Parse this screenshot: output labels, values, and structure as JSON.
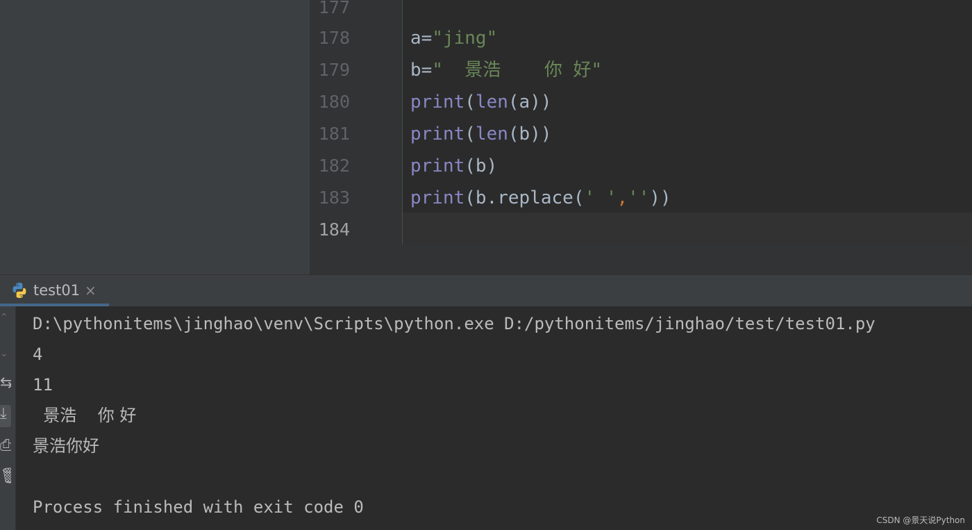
{
  "editor": {
    "lines": [
      {
        "num": "177",
        "code": ""
      },
      {
        "num": "178",
        "parts": [
          [
            "op",
            "a="
          ],
          [
            "str",
            "\"jing\""
          ]
        ]
      },
      {
        "num": "179",
        "parts": [
          [
            "op",
            "b="
          ],
          [
            "str",
            "\"  景浩    你 好\""
          ]
        ]
      },
      {
        "num": "180",
        "parts": [
          [
            "kw",
            "print"
          ],
          [
            "op",
            "("
          ],
          [
            "kw",
            "len"
          ],
          [
            "op",
            "(a))"
          ]
        ]
      },
      {
        "num": "181",
        "parts": [
          [
            "kw",
            "print"
          ],
          [
            "op",
            "("
          ],
          [
            "kw",
            "len"
          ],
          [
            "op",
            "(b))"
          ]
        ]
      },
      {
        "num": "182",
        "parts": [
          [
            "kw",
            "print"
          ],
          [
            "op",
            "(b)"
          ]
        ]
      },
      {
        "num": "183",
        "parts": [
          [
            "kw",
            "print"
          ],
          [
            "op",
            "(b.replace("
          ],
          [
            "str",
            "' '"
          ],
          [
            "comma",
            ","
          ],
          [
            "str",
            "''"
          ],
          [
            "op",
            "))"
          ]
        ]
      },
      {
        "num": "184",
        "code": ""
      }
    ]
  },
  "run": {
    "tab_label": "test01",
    "close_glyph": "×",
    "icons": [
      "python-icon",
      "close-icon",
      "scroll-up-icon",
      "scroll-down-icon",
      "soft-wrap-icon",
      "scroll-to-end-icon",
      "print-icon",
      "delete-icon"
    ],
    "output": [
      "D:\\pythonitems\\jinghao\\venv\\Scripts\\python.exe D:/pythonitems/jinghao/test/test01.py",
      "4",
      "11",
      "  景浩    你 好",
      "景浩你好",
      "",
      "Process finished with exit code 0"
    ]
  },
  "watermark": "CSDN @景天说Python",
  "colors": {
    "editor_bg": "#2b2b2b",
    "keyword": "#8888c6",
    "string": "#6a8759",
    "default_text": "#a9b7c6",
    "comma": "#cc7832"
  }
}
